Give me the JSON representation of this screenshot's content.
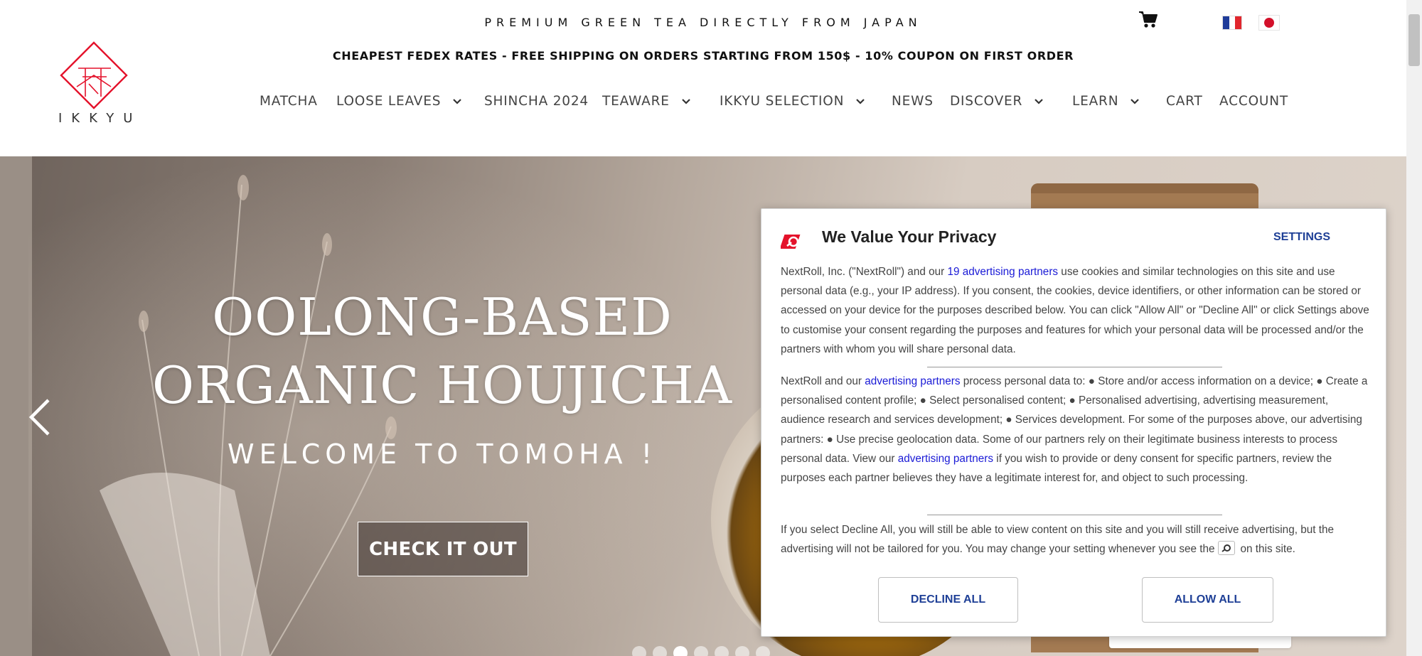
{
  "header": {
    "tagline": "PREMIUM GREEN TEA DIRECTLY FROM JAPAN",
    "promo": "CHEAPEST FEDEX RATES - FREE SHIPPING ON ORDERS STARTING FROM 150$ - 10% COUPON ON FIRST ORDER",
    "logo_text": "IKKYU",
    "icons": {
      "cart": "cart-icon",
      "lang_fr": "france-flag-icon",
      "lang_jp": "japan-flag-icon"
    }
  },
  "nav": {
    "items": [
      {
        "label": "MATCHA",
        "has_dropdown": false
      },
      {
        "label": "LOOSE LEAVES",
        "has_dropdown": true
      },
      {
        "label": "SHINCHA 2024",
        "has_dropdown": false
      },
      {
        "label": "TEAWARE",
        "has_dropdown": true
      },
      {
        "label": "IKKYU SELECTION",
        "has_dropdown": true
      },
      {
        "label": "NEWS",
        "has_dropdown": false
      },
      {
        "label": "DISCOVER",
        "has_dropdown": true
      },
      {
        "label": "LEARN",
        "has_dropdown": true
      },
      {
        "label": "CART",
        "has_dropdown": false
      },
      {
        "label": "ACCOUNT",
        "has_dropdown": false
      }
    ]
  },
  "hero": {
    "title_line1": "OOLONG-BASED",
    "title_line2": "ORGANIC HOUJICHA",
    "subtitle": "WELCOME TO TOMOHA !",
    "cta_label": "CHECK IT OUT",
    "slide_count": 7,
    "active_slide": 3
  },
  "consent": {
    "title": "We Value Your Privacy",
    "settings_label": "SETTINGS",
    "para1_a": "NextRoll, Inc. (\"NextRoll\") and our ",
    "para1_link": "19 advertising partners",
    "para1_b": " use cookies and similar technologies on this site and use personal data (e.g., your IP address). If you consent, the cookies, device identifiers, or other information can be stored or accessed on your device for the purposes described below. You can click \"Allow All\" or \"Decline All\" or click Settings above to customise your consent regarding the purposes and features for which your personal data will be processed and/or the partners with whom you will share personal data.",
    "para2_a": "NextRoll and our ",
    "para2_link1": "advertising partners",
    "para2_b": " process personal data to: ● Store and/or access information on a device; ● Create a personalised content profile; ● Select personalised content; ● Personalised advertising, advertising measurement, audience research and services development; ● Services development. For some of the purposes above, our advertising partners: ● Use precise geolocation data. Some of our partners rely on their legitimate business interests to process personal data. View our ",
    "para2_link2": "advertising partners",
    "para2_c": " if you wish to provide or deny consent for specific partners, review the purposes each partner believes they have a legitimate interest for, and object to such processing.",
    "para3_a": "If you select Decline All, you will still be able to view content on this site and you will still receive advertising, but the advertising will not be tailored for you. You may change your setting whenever you see the",
    "para3_b": "on this site.",
    "decline_label": "DECLINE ALL",
    "allow_label": "ALLOW ALL",
    "brand_color": "#e4122b",
    "button_text_color": "#1e3f96"
  }
}
